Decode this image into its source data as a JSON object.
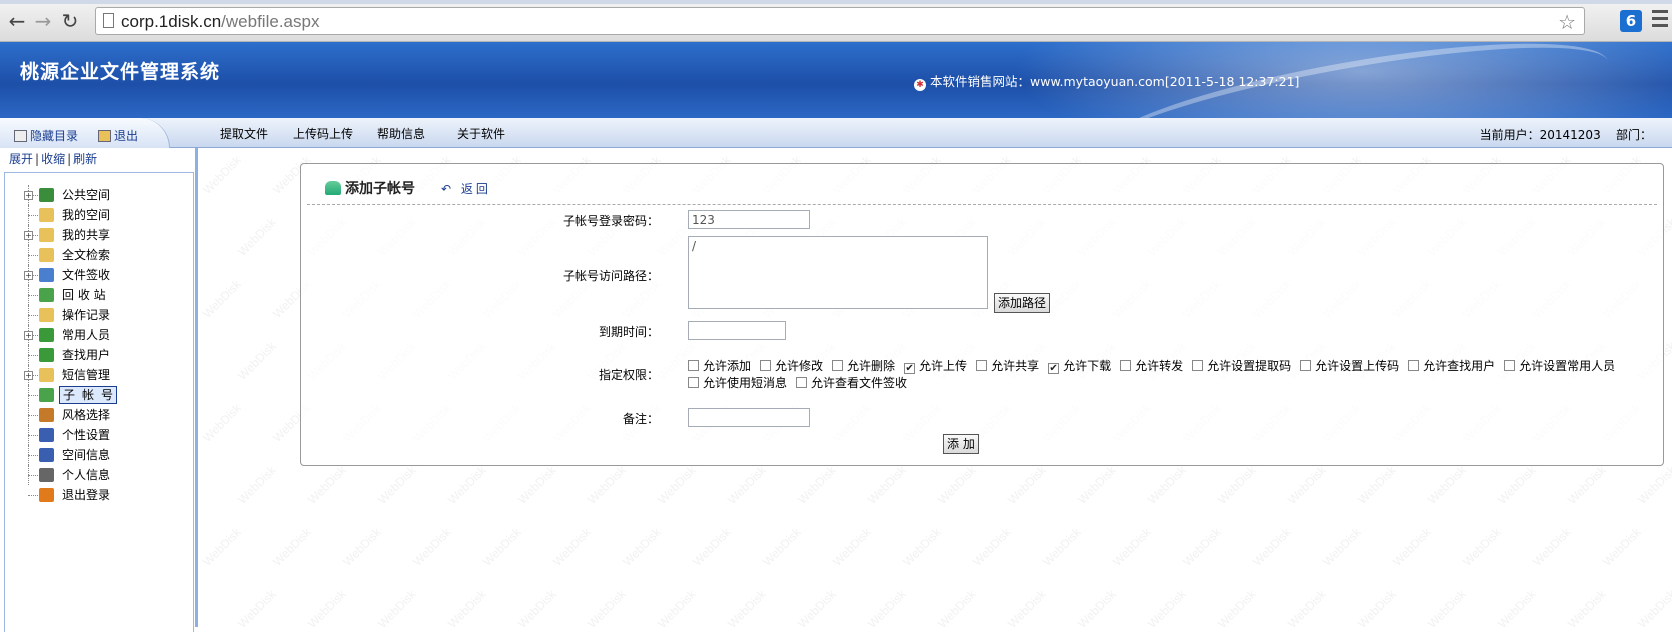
{
  "browser": {
    "url_host": "corp.1disk.cn",
    "url_path": "/webfile.aspx"
  },
  "banner": {
    "title": "桃源企业文件管理系统",
    "notice": "本软件销售网站：www.mytaoyuan.com[2011-5-18 12:37:21]"
  },
  "toolbar": {
    "hide_dir": "隐藏目录",
    "logout": "退出",
    "nav": [
      "提取文件",
      "上传码上传",
      "帮助信息",
      "关于软件"
    ],
    "current_user": "当前用户：20141203",
    "department": "部门："
  },
  "sidebar": {
    "expand": "展开",
    "collapse": "收缩",
    "refresh": "刷新",
    "items": [
      {
        "label": "公共空间",
        "icon": "house-icon",
        "expandable": true,
        "color": "#3a8d3a"
      },
      {
        "label": "我的空间",
        "icon": "folder-icon",
        "expandable": false,
        "color": "#e8c15a"
      },
      {
        "label": "我的共享",
        "icon": "shared-folder-icon",
        "expandable": true,
        "color": "#e8c15a"
      },
      {
        "label": "全文检索",
        "icon": "search-doc-icon",
        "expandable": false,
        "color": "#e8c15a"
      },
      {
        "label": "文件签收",
        "icon": "sign-icon",
        "expandable": true,
        "color": "#4a7ecf"
      },
      {
        "label": "回 收 站",
        "icon": "recycle-icon",
        "expandable": false,
        "color": "#4aa34a"
      },
      {
        "label": "操作记录",
        "icon": "log-icon",
        "expandable": false,
        "color": "#e8c15a"
      },
      {
        "label": "常用人员",
        "icon": "person-icon",
        "expandable": true,
        "color": "#3a9a3a"
      },
      {
        "label": "查找用户",
        "icon": "find-user-icon",
        "expandable": false,
        "color": "#3a9a3a"
      },
      {
        "label": "短信管理",
        "icon": "message-folder-icon",
        "expandable": true,
        "color": "#e8c15a"
      },
      {
        "label": "子帐号",
        "icon": "users-icon",
        "expandable": false,
        "color": "#4aa34a",
        "selected": true
      },
      {
        "label": "风格选择",
        "icon": "style-icon",
        "expandable": false,
        "color": "#c57a2a"
      },
      {
        "label": "个性设置",
        "icon": "settings-grid-icon",
        "expandable": false,
        "color": "#3a5fb0"
      },
      {
        "label": "空间信息",
        "icon": "info-icon",
        "expandable": false,
        "color": "#3a5fb0"
      },
      {
        "label": "个人信息",
        "icon": "id-card-icon",
        "expandable": false,
        "color": "#666666"
      },
      {
        "label": "退出登录",
        "icon": "exit-icon",
        "expandable": false,
        "color": "#e07a1a"
      }
    ]
  },
  "form": {
    "header": "添加子帐号",
    "back": "返回",
    "password_label": "子帐号登录密码：",
    "password_value": "123",
    "path_label": "子帐号访问路径：",
    "path_value": "/",
    "add_path_button": "添加路径",
    "expire_label": "到期时间：",
    "expire_value": "",
    "perm_label": "指定权限：",
    "permissions": [
      {
        "label": "允许添加",
        "checked": false
      },
      {
        "label": "允许修改",
        "checked": false
      },
      {
        "label": "允许删除",
        "checked": false
      },
      {
        "label": "允许上传",
        "checked": true
      },
      {
        "label": "允许共享",
        "checked": false
      },
      {
        "label": "允许下载",
        "checked": true
      },
      {
        "label": "允许转发",
        "checked": false
      },
      {
        "label": "允许设置提取码",
        "checked": false
      },
      {
        "label": "允许设置上传码",
        "checked": false
      },
      {
        "label": "允许查找用户",
        "checked": false
      },
      {
        "label": "允许设置常用人员",
        "checked": false
      },
      {
        "label": "允许使用短消息",
        "checked": false
      },
      {
        "label": "允许查看文件签收",
        "checked": false
      }
    ],
    "remark_label": "备注：",
    "remark_value": "",
    "submit_button": "添 加"
  },
  "watermark": "WebDisk"
}
